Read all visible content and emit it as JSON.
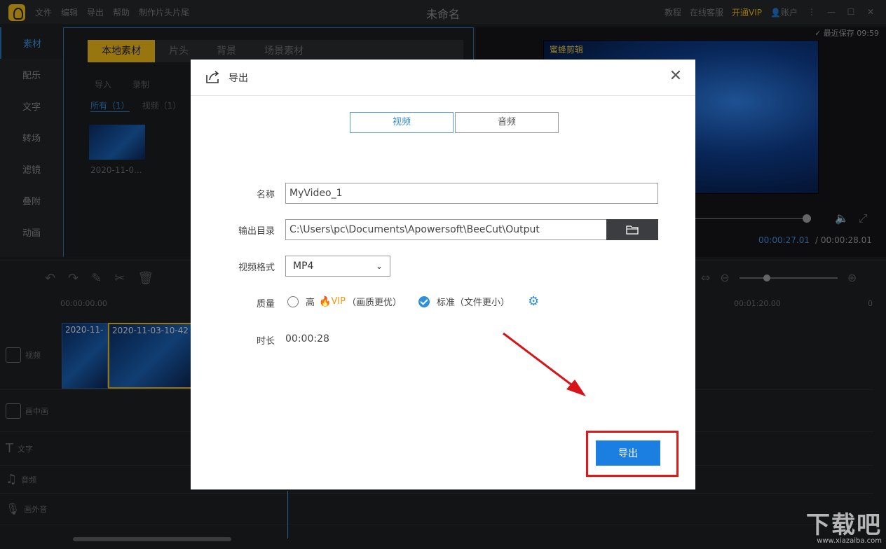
{
  "app": {
    "title": "未命名",
    "menu": [
      "文件",
      "编辑",
      "导出",
      "帮助",
      "制作片头片尾"
    ],
    "right_menu": [
      "教程",
      "在线客服",
      "开通VIP",
      "账户"
    ]
  },
  "left_nav": [
    "素材",
    "配乐",
    "文字",
    "转场",
    "滤镜",
    "叠附",
    "动画"
  ],
  "library": {
    "tabs": [
      "本地素材",
      "片头",
      "背景",
      "场景素材"
    ],
    "tools": [
      "导入",
      "录制"
    ],
    "filters": [
      "所有（1）",
      "视频（1）"
    ],
    "thumb_label": "2020-11-0..."
  },
  "preview": {
    "save_status": "最近保存 09:59",
    "watermark": "蜜蜂剪辑",
    "current_time": "00:00:27.01",
    "total_time": "00:00:28.01"
  },
  "timeline": {
    "ruler": [
      "00:00:00.00",
      "00:01:20.00",
      "0"
    ],
    "tracks": [
      "视频",
      "画中画",
      "文字",
      "音频",
      "画外音"
    ],
    "clips": [
      "2020-11-",
      "2020-11-03-10-42"
    ]
  },
  "dialog": {
    "title": "导出",
    "tabs": [
      "视频",
      "音频"
    ],
    "name_label": "名称",
    "name_value": "MyVideo_1",
    "dir_label": "输出目录",
    "dir_value": "C:\\Users\\pc\\Documents\\Apowersoft\\BeeCut\\Output",
    "format_label": "视频格式",
    "format_value": "MP4",
    "quality_label": "质量",
    "quality_high": "高",
    "quality_vip": "VIP",
    "quality_high_note": "（画质更优）",
    "quality_standard": "标准（文件更小）",
    "duration_label": "时长",
    "duration_value": "00:00:28",
    "export_button": "导出"
  },
  "corner_watermark": {
    "text": "下载吧",
    "url": "www.xiazaiba.com"
  },
  "colors": {
    "accent": "#1a7fe0",
    "highlight": "#e01818",
    "brand": "#e8b418"
  }
}
